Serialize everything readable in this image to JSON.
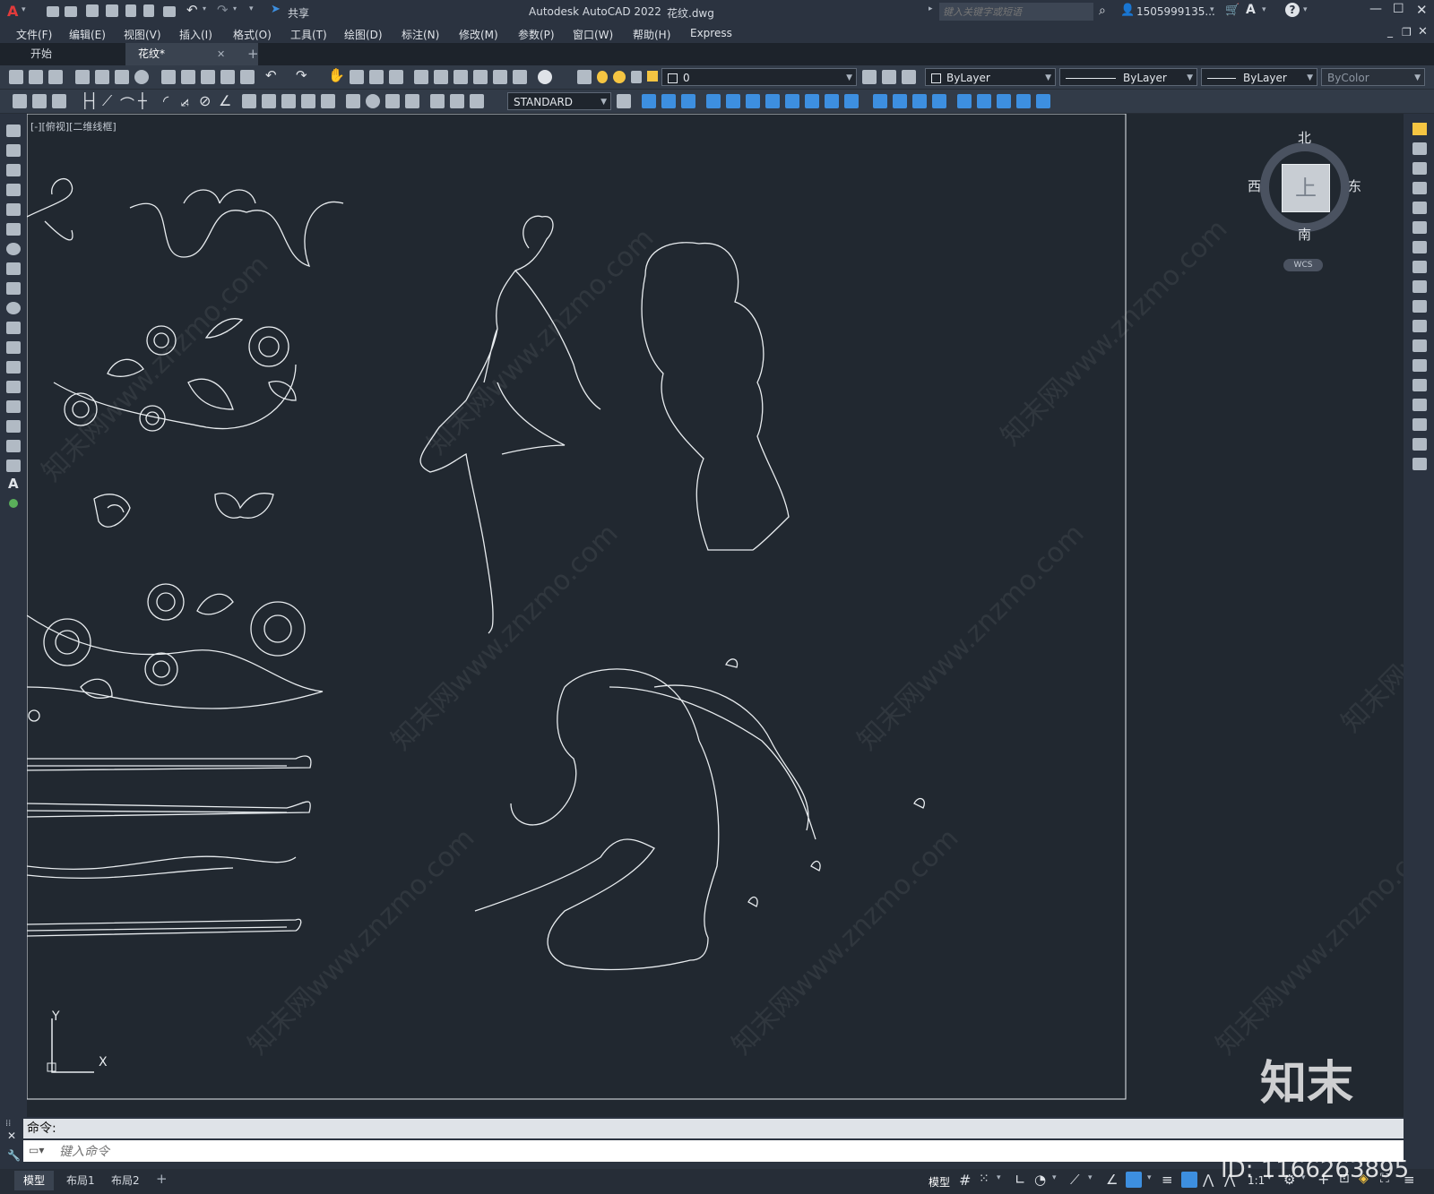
{
  "titlebar": {
    "app_title": "Autodesk AutoCAD 2022",
    "file_name": "花纹.dwg",
    "share_label": "共享",
    "search_placeholder": "键入关键字或短语",
    "user": "1505999135...",
    "window_controls": [
      "minimize-icon",
      "maximize-icon",
      "close-icon"
    ]
  },
  "menubar": {
    "items": [
      "文件(F)",
      "编辑(E)",
      "视图(V)",
      "插入(I)",
      "格式(O)",
      "工具(T)",
      "绘图(D)",
      "标注(N)",
      "修改(M)",
      "参数(P)",
      "窗口(W)",
      "帮助(H)",
      "Express"
    ]
  },
  "tabs": {
    "items": [
      "开始",
      "花纹*"
    ],
    "active": 1,
    "close_glyph": "✕",
    "add_glyph": "+"
  },
  "toolbar": {
    "layer_value": "0",
    "color_value": "ByLayer",
    "linetype_value": "ByLayer",
    "lineweight_value": "ByLayer",
    "plotstyle_value": "ByColor",
    "text_style_value": "STANDARD"
  },
  "viewport": {
    "label": "[-][俯视][二维线框]",
    "ucs_x": "X",
    "ucs_y": "Y"
  },
  "viewcube": {
    "north": "北",
    "south": "南",
    "east": "东",
    "west": "西",
    "top": "上",
    "wcs": "WCS"
  },
  "command": {
    "label": "命令:",
    "placeholder": "键入命令"
  },
  "layout_tabs": {
    "items": [
      "模型",
      "布局1",
      "布局2"
    ],
    "active": 0,
    "add_glyph": "+"
  },
  "statusbar": {
    "model_label": "模型",
    "scale_label": "1:1"
  },
  "watermark": {
    "site": "知末网www.znzmo.com",
    "logo": "知末",
    "id": "ID: 1166263895"
  },
  "colors": {
    "canvas_bg": "#212830",
    "panel_bg": "#2b3340",
    "linework": "#e8ecef",
    "accent_blue": "#3d8fe0"
  }
}
